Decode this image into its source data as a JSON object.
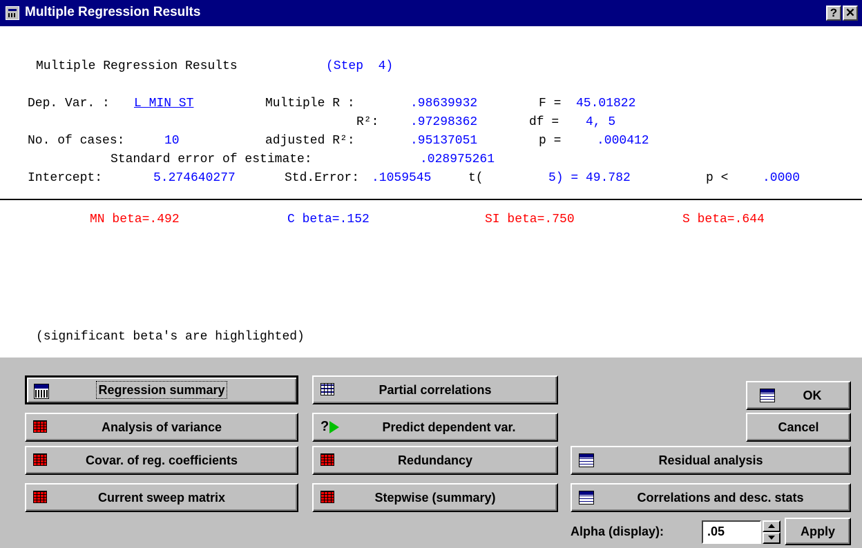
{
  "window": {
    "title": "Multiple Regression Results",
    "help_label": "?",
    "close_label": "✕"
  },
  "results": {
    "heading": "Multiple Regression Results",
    "step": "(Step  4)",
    "dep_var_label": "Dep. Var. :",
    "dep_var": "L_MIN_ST",
    "multiple_r_label": "Multiple R :",
    "multiple_r": ".98639932",
    "f_label": "F =",
    "f_value": "45.01822",
    "r2_label": "R²:",
    "r2": ".97298362",
    "df_label": "df =",
    "df_value": "4, 5",
    "cases_label": "No. of cases:",
    "cases": "10",
    "adj_r2_label": "adjusted R²:",
    "adj_r2": ".95137051",
    "p_label": "p =",
    "p_value": ".000412",
    "std_err_est_label": "Standard error of estimate:",
    "std_err_est": ".028975261",
    "intercept_label": "Intercept:",
    "intercept": "5.274640277",
    "std_error_label": "Std.Error:",
    "std_error": ".1059545",
    "t_label": "t(",
    "t_value": "5) = 49.782",
    "p2_label": "p <",
    "p2_value": ".0000"
  },
  "betas": [
    {
      "text": "MN beta=.492",
      "color": "#ff0000"
    },
    {
      "text": "C beta=.152",
      "color": "#0000ff"
    },
    {
      "text": "SI beta=.750",
      "color": "#ff0000"
    },
    {
      "text": "S beta=.644",
      "color": "#ff0000"
    }
  ],
  "note": "(significant beta's are highlighted)",
  "buttons": {
    "regression_summary": "Regression summary",
    "analysis_of_variance": "Analysis of variance",
    "covar_reg_coeff": "Covar. of reg. coefficients",
    "current_sweep": "Current sweep matrix",
    "partial_correlations": "Partial correlations",
    "predict_dependent": "Predict dependent var.",
    "redundancy": "Redundancy",
    "stepwise": "Stepwise (summary)",
    "ok": "OK",
    "cancel": "Cancel",
    "residual_analysis": "Residual analysis",
    "correlations_desc": "Correlations and desc. stats",
    "apply": "Apply"
  },
  "alpha": {
    "label": "Alpha (display):",
    "value": ".05"
  },
  "icons": {
    "app": "statistica-app-icon",
    "summary": "summary-table-icon",
    "grid": "spreadsheet-grid-icon",
    "predict": "question-arrow-icon",
    "sheet": "sheet-icon"
  }
}
